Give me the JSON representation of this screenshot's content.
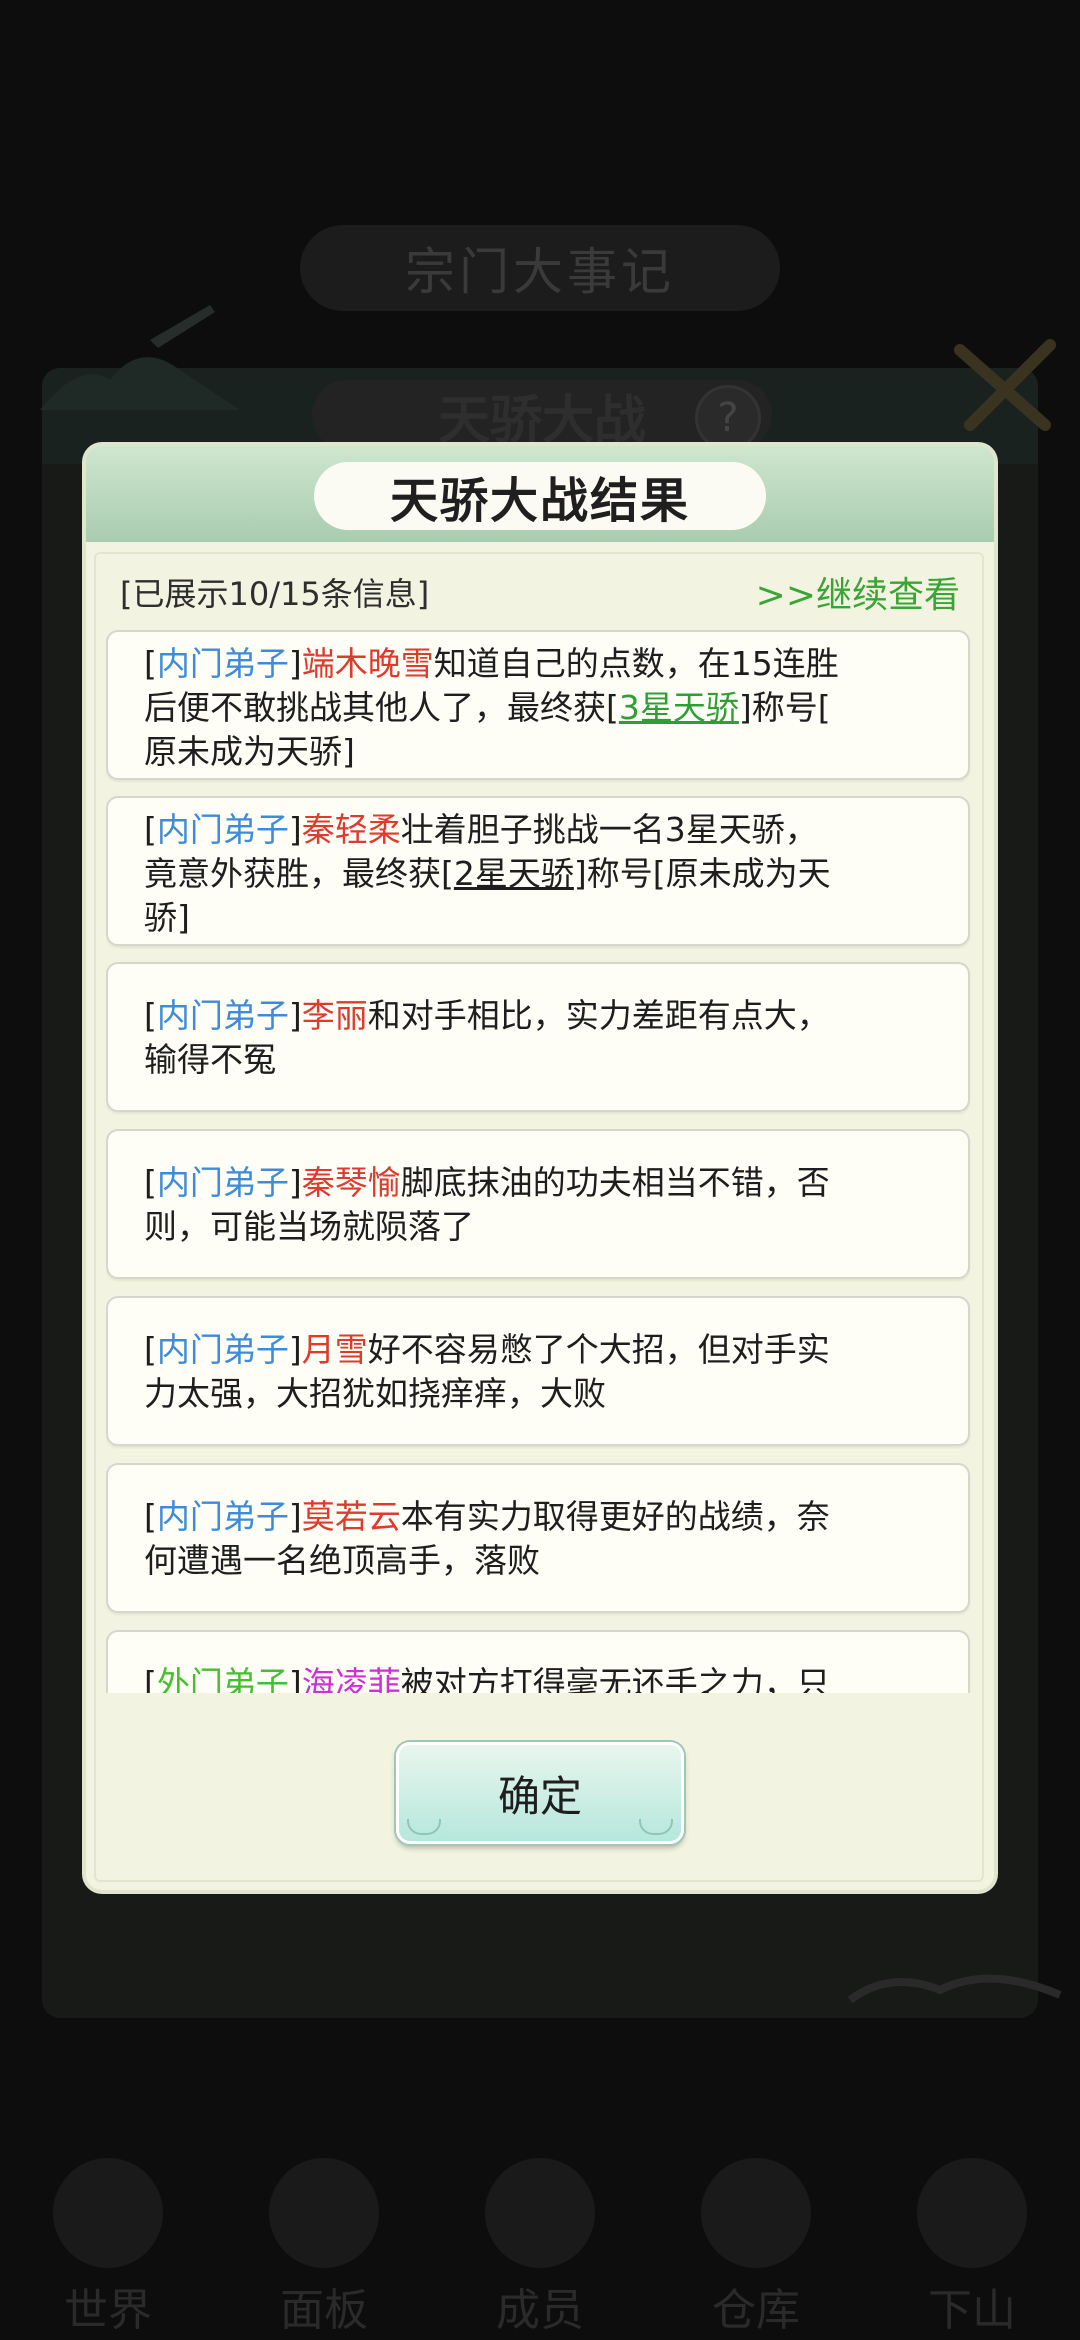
{
  "background": {
    "top_title": "宗门大事记",
    "sub_title": "天骄大战",
    "help_icon": "?",
    "nav_items": [
      {
        "label": "世界",
        "icon": "world-icon"
      },
      {
        "label": "面板",
        "icon": "panel-icon"
      },
      {
        "label": "成员",
        "icon": "members-icon"
      },
      {
        "label": "仓库",
        "icon": "warehouse-icon"
      },
      {
        "label": "下山",
        "icon": "descend-icon"
      }
    ]
  },
  "modal": {
    "title": "天骄大战结果",
    "status": "[已展示10/15条信息]",
    "more_link": ">>继续查看",
    "confirm_label": "确定",
    "entries": [
      {
        "rank": "内门弟子",
        "name": "端木晚雪",
        "line1_rest": "知道自己的点数，在15连胜",
        "line2_pre": "后便不敢挑战其他人了，最终获[",
        "title": "3星天骄",
        "line2_post": "]称号[",
        "line3": "原未成为天骄]"
      },
      {
        "rank": "内门弟子",
        "name": "秦轻柔",
        "line1_rest": "壮着胆子挑战一名3星天骄，",
        "line2_pre": "竟意外获胜，最终获[",
        "title": "2星天骄",
        "line2_post": "]称号[原未成为天",
        "line3": "骄]"
      },
      {
        "rank": "内门弟子",
        "name": "李丽",
        "line1_rest": "和对手相比，实力差距有点大，",
        "line2": "输得不冤"
      },
      {
        "rank": "内门弟子",
        "name": "秦琴愉",
        "line1_rest": "脚底抹油的功夫相当不错，否",
        "line2": "则，可能当场就陨落了"
      },
      {
        "rank": "内门弟子",
        "name": "月雪",
        "line1_rest": "好不容易憋了个大招，但对手实",
        "line2": "力太强，大招犹如挠痒痒，大败"
      },
      {
        "rank": "内门弟子",
        "name": "莫若云",
        "line1_rest": "本有实力取得更好的战绩，奈",
        "line2": "何遭遇一名绝顶高手，落败"
      },
      {
        "rank": "外门弟子",
        "name": "海凌菲",
        "line1_rest": "被对方打得毫无还手之力，只"
      }
    ]
  }
}
